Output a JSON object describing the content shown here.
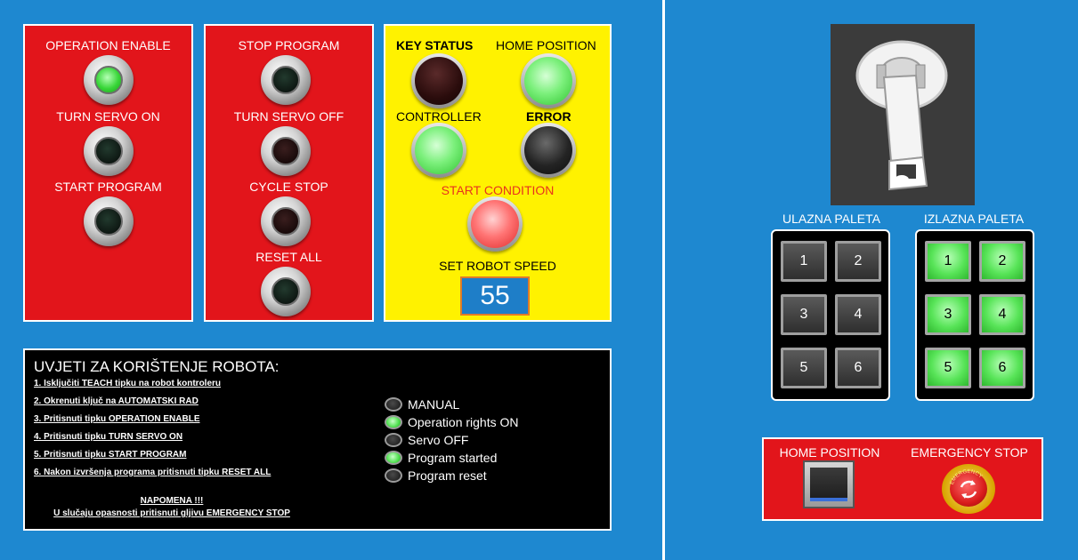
{
  "panel1": {
    "operation_enable": "OPERATION ENABLE",
    "turn_servo_on": "TURN SERVO ON",
    "start_program": "START PROGRAM"
  },
  "panel2": {
    "stop_program": "STOP PROGRAM",
    "turn_servo_off": "TURN SERVO OFF",
    "cycle_stop": "CYCLE STOP",
    "reset_all": "RESET ALL"
  },
  "status_panel": {
    "key_status": "KEY STATUS",
    "home_position": "HOME POSITION",
    "controller": "CONTROLLER",
    "error": "ERROR",
    "start_condition": "START CONDITION",
    "start_condition_color": "#e8331e",
    "set_robot_speed": "SET ROBOT SPEED",
    "robot_speed": "55"
  },
  "instructions": {
    "title": "UVJETI ZA KORIŠTENJE ROBOTA:",
    "steps": [
      "1. Isključiti TEACH tipku na robot kontroleru",
      "2. Okrenuti ključ na AUTOMATSKI RAD",
      "3. Pritisnuti tipku OPERATION ENABLE",
      "4. Pritisnuti tipku TURN SERVO ON",
      "5. Pritisnuti tipku START PROGRAM",
      "6. Nakon izvršenja programa pritisnuti tipku RESET ALL"
    ],
    "note_title": "NAPOMENA !!!",
    "note_text": "U slučaju opasnosti pritisnuti gljivu EMERGENCY STOP"
  },
  "legend": [
    {
      "label": "MANUAL",
      "state": "off"
    },
    {
      "label": "Operation rights ON",
      "state": "on"
    },
    {
      "label": "Servo OFF",
      "state": "off"
    },
    {
      "label": "Program started",
      "state": "on"
    },
    {
      "label": "Program reset",
      "state": "off"
    }
  ],
  "pallets": {
    "input_label": "ULAZNA PALETA",
    "output_label": "IZLAZNA PALETA",
    "input_slots": [
      "1",
      "2",
      "3",
      "4",
      "5",
      "6"
    ],
    "output_slots": [
      "1",
      "2",
      "3",
      "4",
      "5",
      "6"
    ]
  },
  "bottom_panel": {
    "home_position": "HOME POSITION",
    "emergency_stop": "EMERGENCY STOP",
    "emergency_ring_text": "EMERGENCY"
  },
  "colors": {
    "background": "#1e88d0",
    "panel_red": "#e2151b",
    "panel_yellow": "#fff200",
    "lamp_green": "#4ee04e"
  }
}
